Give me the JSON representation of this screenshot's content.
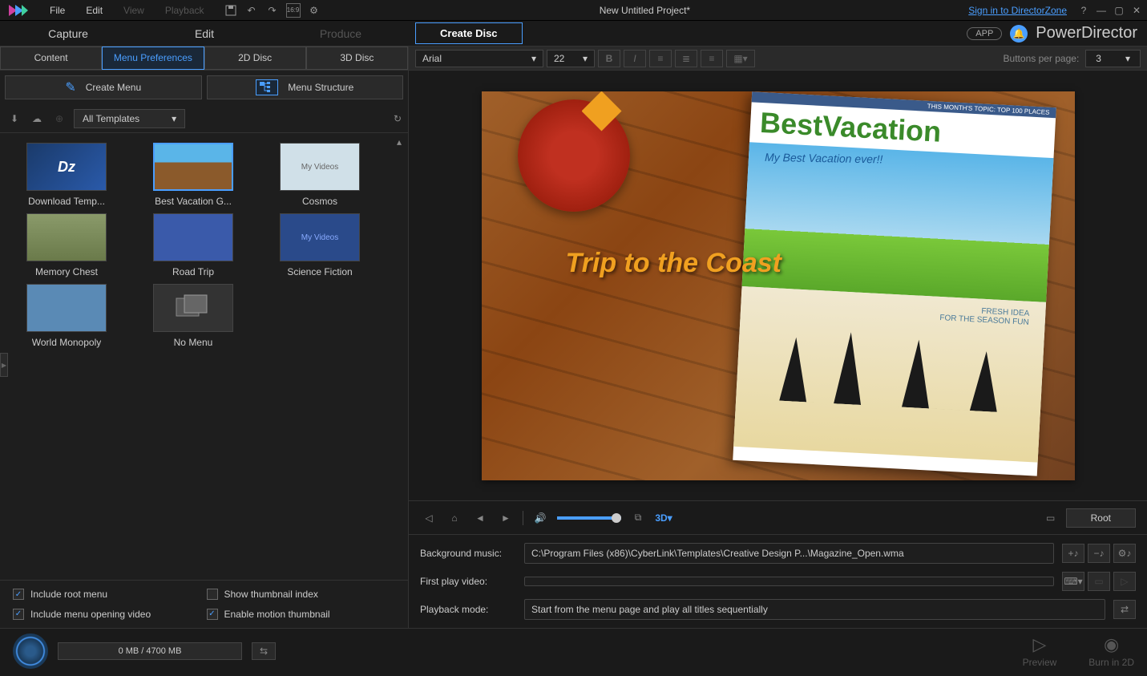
{
  "titlebar": {
    "menus": [
      "File",
      "Edit",
      "View",
      "Playback"
    ],
    "disabled_menus": [
      2,
      3
    ],
    "project_title": "New Untitled Project*",
    "signin": "Sign in to DirectorZone"
  },
  "brand": {
    "app_badge": "APP",
    "name": "PowerDirector"
  },
  "modes": {
    "items": [
      "Capture",
      "Edit",
      "Produce",
      "Create Disc"
    ],
    "active": 3,
    "disabled": [
      2
    ]
  },
  "sub_tabs": {
    "items": [
      "Content",
      "Menu Preferences",
      "2D Disc",
      "3D Disc"
    ],
    "active": 1
  },
  "menu_buttons": {
    "create": "Create Menu",
    "structure": "Menu Structure"
  },
  "filter": {
    "dropdown": "All Templates"
  },
  "templates": [
    {
      "label": "Download Temp...",
      "kind": "dz"
    },
    {
      "label": "Best Vacation G...",
      "kind": "vacation",
      "selected": true
    },
    {
      "label": "Cosmos",
      "kind": "cosmos"
    },
    {
      "label": "Memory Chest",
      "kind": "memory"
    },
    {
      "label": "Road Trip",
      "kind": "road"
    },
    {
      "label": "Science Fiction",
      "kind": "scifi"
    },
    {
      "label": "World Monopoly",
      "kind": "world"
    },
    {
      "label": "No Menu",
      "kind": "nomenu"
    }
  ],
  "checkboxes": {
    "root": {
      "label": "Include root menu",
      "checked": true
    },
    "thumb_index": {
      "label": "Show thumbnail index",
      "checked": false
    },
    "opening": {
      "label": "Include menu opening video",
      "checked": true
    },
    "motion": {
      "label": "Enable motion thumbnail",
      "checked": true
    }
  },
  "text_toolbar": {
    "font": "Arial",
    "size": "22",
    "bpp_label": "Buttons per page:",
    "bpp_value": "3"
  },
  "preview": {
    "title_text": "Trip to the Coast",
    "mag_banner": "THIS MONTH'S TOPIC: TOP 100 PLACES",
    "mag_title1": "Best",
    "mag_title2": "Vacation",
    "mag_subtitle": "My Best Vacation ever!!",
    "fresh1": "FRESH IDEA",
    "fresh2": "FOR THE SEASON FUN"
  },
  "playback": {
    "root_btn": "Root",
    "threed": "3D"
  },
  "settings": {
    "bg_music_label": "Background music:",
    "bg_music_value": "C:\\Program Files (x86)\\CyberLink\\Templates\\Creative Design P...\\Magazine_Open.wma",
    "first_play_label": "First play video:",
    "first_play_value": "",
    "playback_label": "Playback mode:",
    "playback_value": "Start from the menu page and play all titles sequentially"
  },
  "bottom": {
    "progress": "0 MB / 4700 MB",
    "preview_btn": "Preview",
    "burn_btn": "Burn in 2D"
  }
}
